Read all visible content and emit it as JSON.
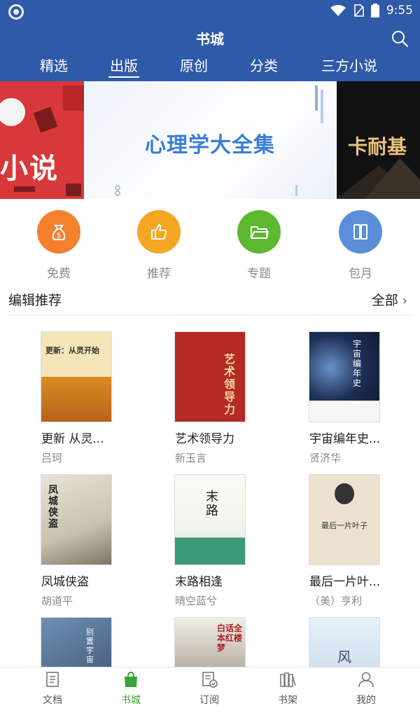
{
  "status_bar": {
    "time": "9:55"
  },
  "header": {
    "title": "书城",
    "tabs": [
      "精选",
      "出版",
      "原创",
      "分类",
      "三方小说"
    ],
    "active_tab": "出版"
  },
  "banner": {
    "left_text": "小说",
    "main_text": "心理学大全集",
    "right_text": "卡耐基"
  },
  "quick_entries": [
    {
      "label": "免费",
      "icon": "money-bag-icon",
      "color": "#f4802e"
    },
    {
      "label": "推荐",
      "icon": "thumbs-up-icon",
      "color": "#f5a623"
    },
    {
      "label": "专题",
      "icon": "folder-icon",
      "color": "#5cb82e"
    },
    {
      "label": "包月",
      "icon": "book-columns-icon",
      "color": "#5a8fd8"
    }
  ],
  "section": {
    "title": "编辑推荐",
    "more_label": "全部"
  },
  "books": [
    {
      "title": "更新 从灵...",
      "author": "吕珂",
      "cover_text": "更新：从灵开始"
    },
    {
      "title": "艺术领导力",
      "author": "新玉言",
      "cover_text": "艺术领导力"
    },
    {
      "title": "宇宙编年史...",
      "author": "贤济华",
      "cover_text": "宇宙编年史"
    },
    {
      "title": "凤城侠盗",
      "author": "胡道平",
      "cover_text": "凤城侠盗"
    },
    {
      "title": "末路相逢",
      "author": "晴空蓝兮",
      "cover_text": "末路"
    },
    {
      "title": "最后一片叶...",
      "author": "（美）亨利",
      "cover_text": "最后一片叶子"
    },
    {
      "title": "",
      "author": "",
      "cover_text": "别置宇宙"
    },
    {
      "title": "",
      "author": "",
      "cover_text": "白话全本红楼梦"
    },
    {
      "title": "",
      "author": "",
      "cover_text": "风"
    }
  ],
  "bottom_nav": [
    {
      "label": "文档",
      "icon": "document-icon"
    },
    {
      "label": "书城",
      "icon": "shopping-bag-icon"
    },
    {
      "label": "订阅",
      "icon": "subscribe-icon"
    },
    {
      "label": "书架",
      "icon": "bookshelf-icon"
    },
    {
      "label": "我的",
      "icon": "user-icon"
    }
  ],
  "colors": {
    "header": "#2f5aa8",
    "active_nav": "#3aa43a"
  }
}
